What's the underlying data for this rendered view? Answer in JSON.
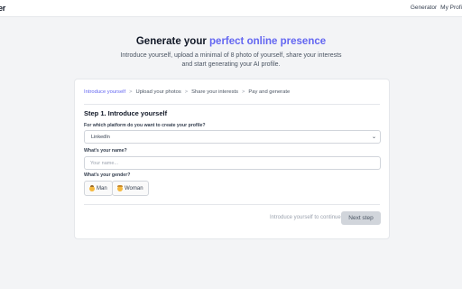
{
  "header": {
    "brand": "er",
    "nav": [
      "Generator",
      "My Profi"
    ]
  },
  "hero": {
    "title_prefix": "Generate your ",
    "title_accent": "perfect online presence",
    "subtitle": "Introduce yourself, upload a minimal of 8 photo of yourself, share your interests and start generating your AI profile."
  },
  "steps": {
    "items": [
      "Introduce yourself",
      "Upload your photos",
      "Share your interests",
      "Pay and generate"
    ],
    "separator": ">"
  },
  "form": {
    "step_title": "Step 1. Introduce yourself",
    "platform_label": "For which platform do you want to create your profile?",
    "platform_value": "LinkedIn",
    "name_label": "What's your name?",
    "name_placeholder": "Your name...",
    "gender_label": "What's your gender?",
    "gender_options": [
      "Man",
      "Woman"
    ]
  },
  "footer": {
    "hint": "Introduce yourself to continue",
    "next_label": "Next step"
  },
  "colors": {
    "accent": "#6366f1",
    "disabled_button": "#d1d5db"
  }
}
